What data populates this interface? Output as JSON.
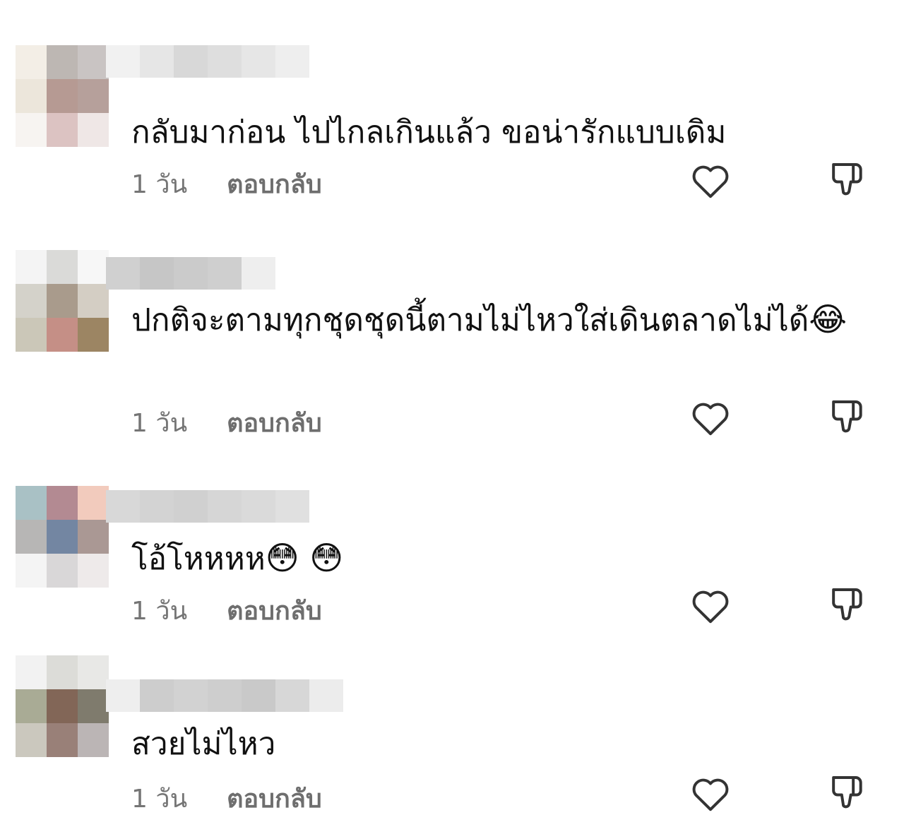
{
  "comments": [
    {
      "text": "กลับมาก่อน ไปไกลเกินแล้ว ขอน่ารักแบบเดิม",
      "time": "1 วัน",
      "reply_label": "ตอบกลับ",
      "like_icon": "heart-icon",
      "dislike_icon": "thumbs-down-icon",
      "avatar_colors": [
        "#f3eee6",
        "#bdb7b3",
        "#c9c4c3",
        "#ece6db",
        "#b69a93",
        "#b6a09b",
        "#f7f4f1",
        "#dcc3c2",
        "#efe7e6"
      ],
      "name_colors": [
        "#f1f1f1",
        "#e6e6e6",
        "#d8d8d8",
        "#dedede",
        "#e6e6e6",
        "#eeeeee"
      ]
    },
    {
      "text": "ปกติจะตามทุกชุดชุดนี้ตามไม่ไหวใส่เดินตลาดไม่ได้",
      "emoji": "😂",
      "time": "1 วัน",
      "reply_label": "ตอบกลับ",
      "like_icon": "heart-icon",
      "dislike_icon": "thumbs-down-icon",
      "avatar_colors": [
        "#f4f4f4",
        "#dadad8",
        "#f7f7f7",
        "#d4d2ca",
        "#a99b8c",
        "#d4cec4",
        "#cbc7b8",
        "#c58f86",
        "#9c8563"
      ],
      "name_colors": [
        "#d0d0d0",
        "#c6c6c6",
        "#cbcbcb",
        "#cfcfcf",
        "#eeeeee"
      ]
    },
    {
      "text": "โอ้โหหหห",
      "emoji": "😳 😳",
      "time": "1 วัน",
      "reply_label": "ตอบกลับ",
      "like_icon": "heart-icon",
      "dislike_icon": "thumbs-down-icon",
      "avatar_colors": [
        "#a9c1c5",
        "#b38a92",
        "#f2cbbd",
        "#b7b6b5",
        "#7386a2",
        "#aa9894",
        "#f4f4f4",
        "#d9d7d8",
        "#eeeaea"
      ],
      "name_colors": [
        "#d8d8d8",
        "#d3d3d3",
        "#d0d0d0",
        "#d6d6d6",
        "#dadada",
        "#e0e0e0"
      ]
    },
    {
      "text": "สวยไม่ไหว",
      "time": "1 วัน",
      "reply_label": "ตอบกลับ",
      "like_icon": "heart-icon",
      "dislike_icon": "thumbs-down-icon",
      "avatar_colors": [
        "#f2f2f2",
        "#dcdcd8",
        "#e8e8e6",
        "#a9ab95",
        "#826657",
        "#7f7b6d",
        "#cbc8be",
        "#998078",
        "#bbb5b5"
      ],
      "name_colors": [
        "#eeeeee",
        "#cdcdcd",
        "#d2d2d2",
        "#cecece",
        "#c9c9c9",
        "#d7d7d7",
        "#ececec"
      ]
    }
  ]
}
